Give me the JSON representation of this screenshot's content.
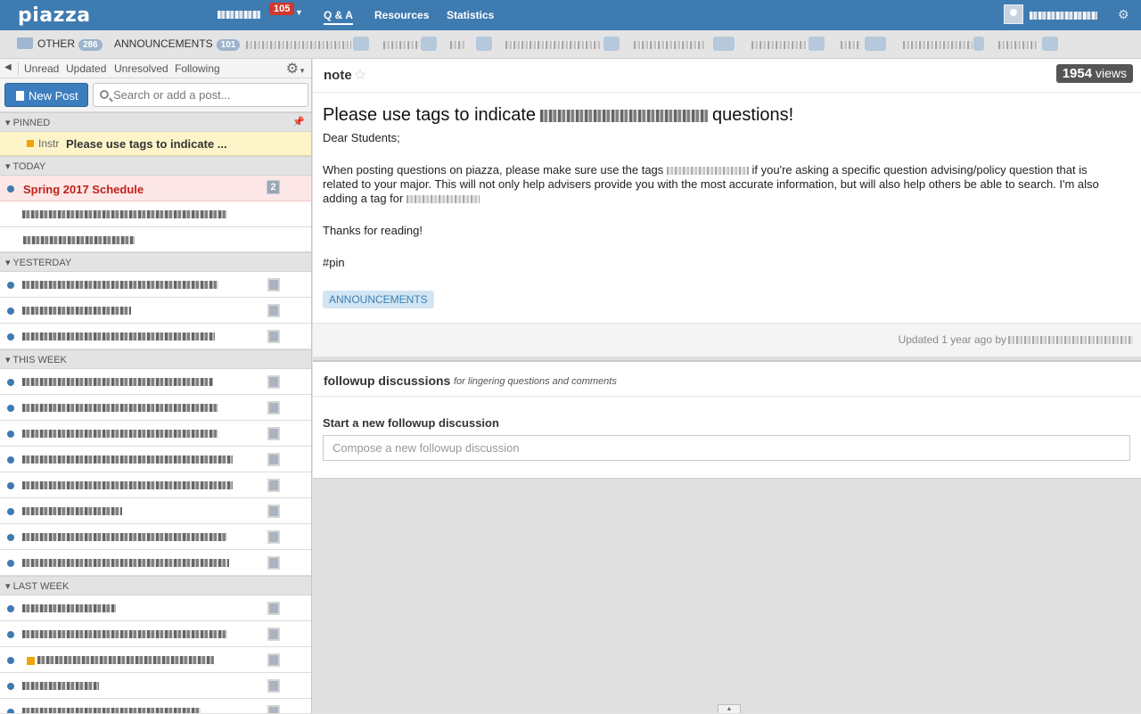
{
  "app": {
    "logo": "piazza"
  },
  "topbar": {
    "class_badge": "105",
    "nav": [
      "Q & A",
      "Resources",
      "Statistics"
    ]
  },
  "folders": {
    "other_label": "OTHER",
    "other_count": "286",
    "ann_label": "ANNOUNCEMENTS",
    "ann_count": "101"
  },
  "sidebar": {
    "filters": [
      "Unread",
      "Updated",
      "Unresolved",
      "Following"
    ],
    "new_post": "New Post",
    "search_placeholder": "Search or add a post...",
    "sections": {
      "pinned": "PINNED",
      "today": "TODAY",
      "yesterday": "YESTERDAY",
      "this_week": "THIS WEEK",
      "last_week": "LAST WEEK"
    },
    "pinned_item": {
      "prefix": "Instr",
      "title": "Please use tags to indicate ..."
    },
    "schedule_item": {
      "title": "Spring 2017 Schedule",
      "count": "2"
    }
  },
  "post": {
    "type": "note",
    "views_count": "1954",
    "views_label": " views",
    "title_start": "Please use tags to indicate",
    "title_end": "questions!",
    "greeting": "Dear Students;",
    "para_a": "When posting questions on piazza, please make sure use the tags",
    "para_b": "if you're asking a specific question advising/policy question that is related to your major. This will not only help advisers provide you with the most accurate information, but will also help others be able to search. I'm also adding a tag for",
    "thanks": "Thanks for reading!",
    "hashtag": "#pin",
    "tag": "ANNOUNCEMENTS",
    "updated": "Updated 1 year ago by"
  },
  "followup": {
    "title": "followup discussions",
    "subtitle": "for lingering questions and comments",
    "start_label": "Start a new followup discussion",
    "compose_placeholder": "Compose a new followup discussion"
  },
  "colors": {
    "brand": "#3e7bb1",
    "pinned_bg": "#fdf5c9",
    "schedule_text": "#c1221c"
  }
}
